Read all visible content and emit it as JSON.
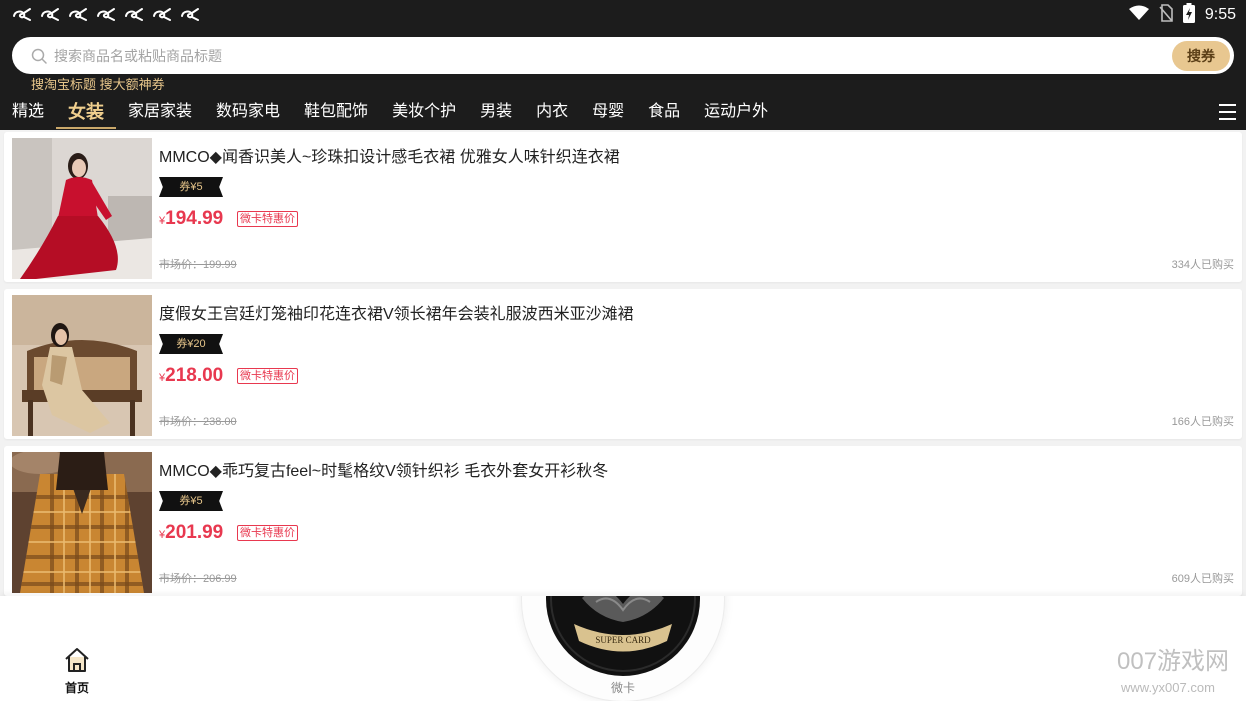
{
  "status_bar": {
    "time": "9:55",
    "notification_icons": [
      "app-notification-icon",
      "app-notification-icon",
      "app-notification-icon",
      "app-notification-icon",
      "app-notification-icon",
      "app-notification-icon",
      "app-notification-icon"
    ],
    "status_icons": [
      "wifi-icon",
      "no-sim-icon",
      "battery-charging-icon"
    ]
  },
  "search": {
    "placeholder": "搜索商品名或粘贴商品标题",
    "button_label": "搜券",
    "hint": "搜淘宝标题 搜大额神券"
  },
  "categories": [
    {
      "label": "精选"
    },
    {
      "label": "女装",
      "selected": true
    },
    {
      "label": "家居家装"
    },
    {
      "label": "数码家电"
    },
    {
      "label": "鞋包配饰"
    },
    {
      "label": "美妆个护"
    },
    {
      "label": "男装"
    },
    {
      "label": "内衣"
    },
    {
      "label": "母婴"
    },
    {
      "label": "食品"
    },
    {
      "label": "运动户外"
    }
  ],
  "menu_icon": "hamburger-menu-icon",
  "products": [
    {
      "title": "MMCO◆闻香识美人~珍珠扣设计感毛衣裙 优雅女人味针织连衣裙",
      "coupon": "券¥5",
      "currency": "¥",
      "price": "194.99",
      "price_tag": "微卡特惠价",
      "market_price": "市场价：199.99",
      "sold": "334人已购买"
    },
    {
      "title": "度假女王宫廷灯笼袖印花连衣裙V领长裙年会装礼服波西米亚沙滩裙",
      "coupon": "券¥20",
      "currency": "¥",
      "price": "218.00",
      "price_tag": "微卡特惠价",
      "market_price": "市场价：238.00",
      "sold": "166人已购买"
    },
    {
      "title": "MMCO◆乖巧复古feel~时髦格纹V领针织衫 毛衣外套女开衫秋冬",
      "coupon": "券¥5",
      "currency": "¥",
      "price": "201.99",
      "price_tag": "微卡特惠价",
      "market_price": "市场价：206.99",
      "sold": "609人已购买"
    }
  ],
  "bottom_nav": {
    "home_label": "首页",
    "home_icon": "home-icon",
    "center_label": "微卡",
    "center_logo_text": "SUPER CARD"
  },
  "watermark": {
    "text": "007游戏网",
    "url": "www.yx007.com"
  },
  "colors": {
    "header_bg": "#1c1c1c",
    "accent_gold": "#e8c790",
    "price_red": "#e8384f",
    "page_bg": "#f2f2f2"
  }
}
